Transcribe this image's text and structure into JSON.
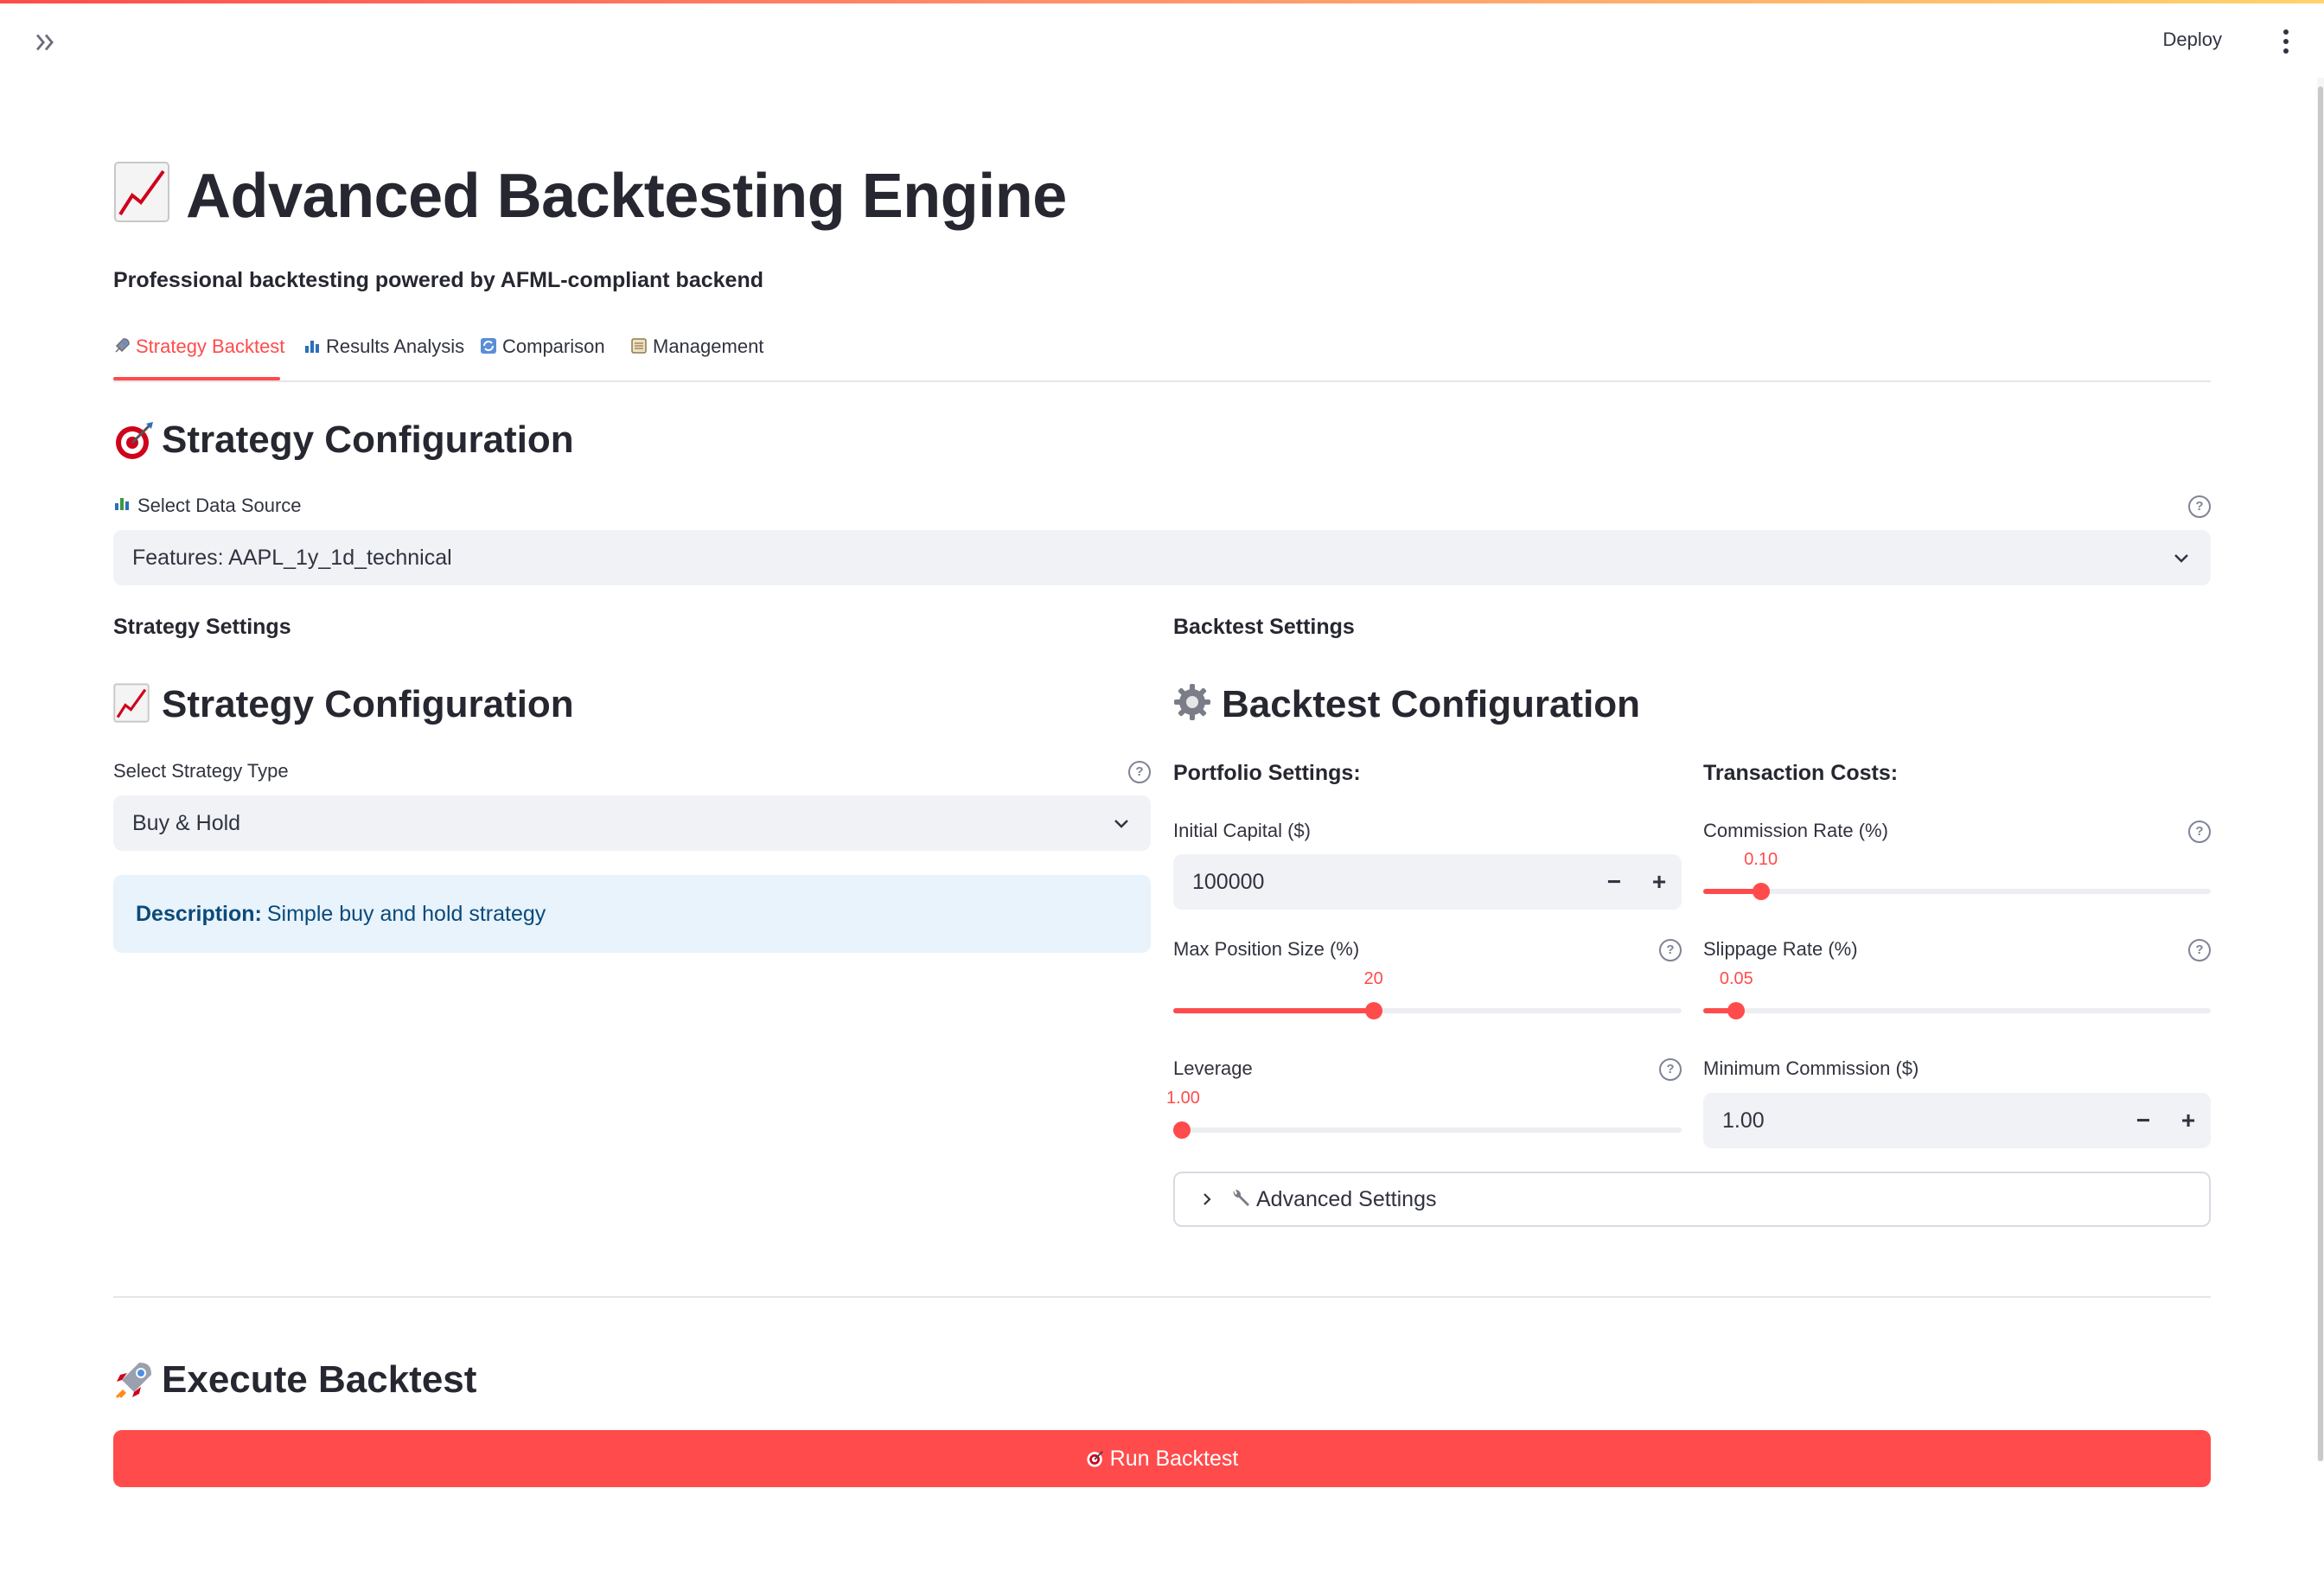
{
  "header": {
    "deploy_label": "Deploy",
    "expand_icon": "double-chevron-right-icon",
    "menu_icon": "kebab-menu-icon"
  },
  "page": {
    "title_icon": "chart-increasing-icon",
    "title": "Advanced Backtesting Engine",
    "subtitle": "Professional backtesting powered by AFML-compliant backend"
  },
  "tabs": [
    {
      "icon": "rocket-icon",
      "label": "Strategy Backtest",
      "active": true
    },
    {
      "icon": "bar-chart-icon",
      "label": "Results Analysis",
      "active": false
    },
    {
      "icon": "refresh-icon",
      "label": "Comparison",
      "active": false
    },
    {
      "icon": "ledger-icon",
      "label": "Management",
      "active": false
    }
  ],
  "strategy_config": {
    "icon": "target-icon",
    "heading": "Strategy Configuration",
    "data_source": {
      "icon": "bar-chart-icon",
      "label": "Select Data Source",
      "value": "Features: AAPL_1y_1d_technical"
    }
  },
  "left": {
    "section_label": "Strategy Settings",
    "heading_icon": "chart-increasing-icon",
    "heading": "Strategy Configuration",
    "strategy_type": {
      "label": "Select Strategy Type",
      "value": "Buy & Hold"
    },
    "description": {
      "prefix": "Description:",
      "text": "Simple buy and hold strategy"
    }
  },
  "right": {
    "section_label": "Backtest Settings",
    "heading_icon": "gear-icon",
    "heading": "Backtest Configuration",
    "portfolio": {
      "heading": "Portfolio Settings:",
      "initial_capital": {
        "label": "Initial Capital ($)",
        "value": "100000"
      },
      "max_position": {
        "label": "Max Position Size (%)",
        "value": "20",
        "fraction": 0.39
      },
      "leverage": {
        "label": "Leverage",
        "value": "1.00",
        "fraction": 0.0
      }
    },
    "costs": {
      "heading": "Transaction Costs:",
      "commission": {
        "label": "Commission Rate (%)",
        "value": "0.10",
        "fraction": 0.1
      },
      "slippage": {
        "label": "Slippage Rate (%)",
        "value": "0.05",
        "fraction": 0.05
      },
      "min_commission": {
        "label": "Minimum Commission ($)",
        "value": "1.00"
      }
    },
    "advanced": {
      "icon": "wrench-icon",
      "label": "Advanced Settings"
    }
  },
  "execute": {
    "icon": "rocket-icon",
    "heading": "Execute Backtest",
    "button_icon": "target-icon",
    "button_label": "Run Backtest"
  },
  "colors": {
    "accent": "#ff4b4b",
    "info_bg": "#e8f3fc",
    "input_bg": "#f0f2f6"
  }
}
